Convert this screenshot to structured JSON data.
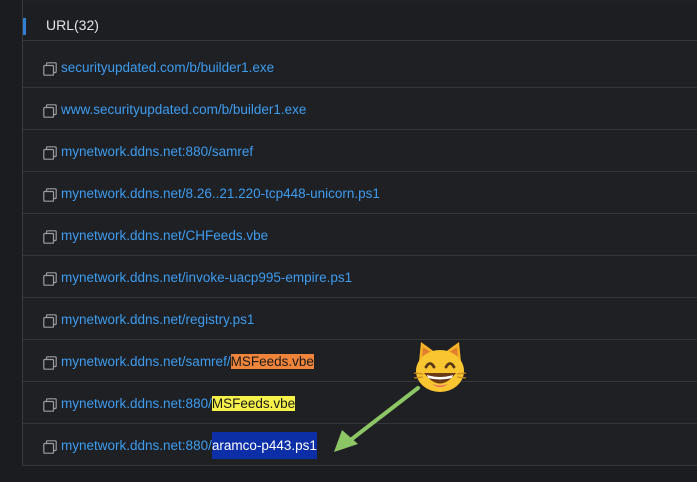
{
  "section": {
    "title": "URL(32)"
  },
  "urls": [
    {
      "prefix": "securityupdated.com/b/builder1.exe",
      "highlight": "",
      "style": ""
    },
    {
      "prefix": "www.securityupdated.com/b/builder1.exe",
      "highlight": "",
      "style": ""
    },
    {
      "prefix": "mynetwork.ddns.net:880/samref",
      "highlight": "",
      "style": ""
    },
    {
      "prefix": "mynetwork.ddns.net/8.26..21.220-tcp448-unicorn.ps1",
      "highlight": "",
      "style": ""
    },
    {
      "prefix": "mynetwork.ddns.net/CHFeeds.vbe",
      "highlight": "",
      "style": ""
    },
    {
      "prefix": "mynetwork.ddns.net/invoke-uacp995-empire.ps1",
      "highlight": "",
      "style": ""
    },
    {
      "prefix": "mynetwork.ddns.net/registry.ps1",
      "highlight": "",
      "style": ""
    },
    {
      "prefix": "mynetwork.ddns.net/samref/",
      "highlight": "MSFeeds.vbe",
      "style": "orange"
    },
    {
      "prefix": "mynetwork.ddns.net:880/",
      "highlight": "MSFeeds.vbe",
      "style": "yellow"
    },
    {
      "prefix": "mynetwork.ddns.net:880/",
      "highlight": "aramco-p443.ps1",
      "style": "blue"
    }
  ],
  "icons": {
    "row_icon": "copy-icon",
    "emoji": "grinning-cat-emoji",
    "arrow": "green-arrow"
  },
  "colors": {
    "link": "#3d9cf0",
    "highlight_orange": "#f0843a",
    "highlight_yellow": "#f7f24a",
    "highlight_blue": "#0c2fa8",
    "arrow": "#8cc665"
  }
}
